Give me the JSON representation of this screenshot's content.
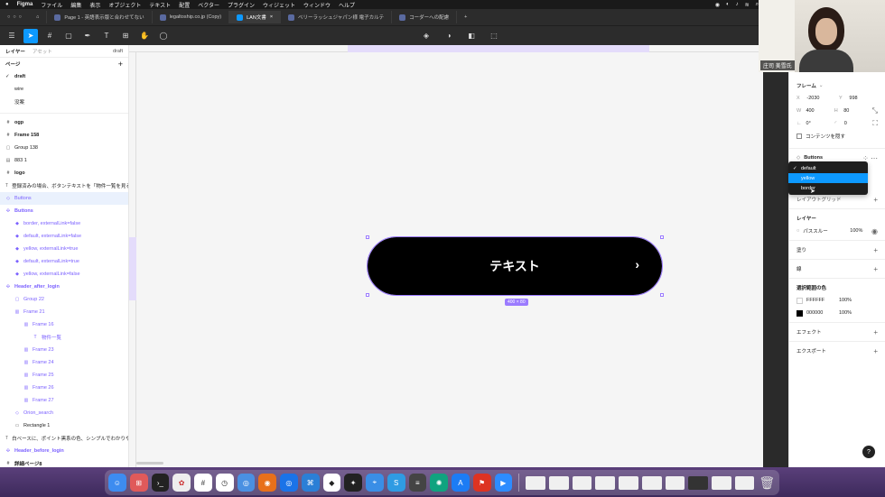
{
  "menubar": {
    "apple": "",
    "items": [
      "Figma",
      "ファイル",
      "編集",
      "表示",
      "オブジェクト",
      "テキスト",
      "配置",
      "ベクター",
      "プラグイン",
      "ウィジェット",
      "ウィンドウ",
      "ヘルプ"
    ]
  },
  "tabs": [
    {
      "label": "Page 1 - 英語表示版と合わせてない"
    },
    {
      "label": "legaltoship.co.jp (Copy)"
    },
    {
      "label": "LAN文書"
    },
    {
      "label": "ベリーラッシュジャパン様 電子カルテ"
    },
    {
      "label": "コーダーへの配慮"
    }
  ],
  "left_panel": {
    "tab_layers": "レイヤー",
    "tab_assets": "アセット",
    "version": "draft",
    "pages_title": "ページ",
    "add": "+",
    "pages": [
      {
        "label": "draft",
        "current": true
      },
      {
        "label": "wire",
        "current": false
      },
      {
        "label": "没案",
        "current": false
      }
    ],
    "layers": [
      {
        "label": "ogp",
        "indent": 0,
        "purple": false,
        "bold": true,
        "icon": "#",
        "hl": false
      },
      {
        "label": "Frame 158",
        "indent": 0,
        "purple": false,
        "bold": true,
        "icon": "#",
        "hl": false
      },
      {
        "label": "Group 138",
        "indent": 0,
        "purple": false,
        "bold": false,
        "icon": "▢",
        "hl": false
      },
      {
        "label": "883 1",
        "indent": 0,
        "purple": false,
        "bold": false,
        "icon": "▤",
        "hl": false
      },
      {
        "label": "logo",
        "indent": 0,
        "purple": false,
        "bold": true,
        "icon": "#",
        "hl": false
      },
      {
        "label": "登録済みの場合、ボタンテキストを「物件一覧を見る」",
        "indent": 0,
        "purple": false,
        "bold": false,
        "icon": "T",
        "hl": false
      },
      {
        "label": "Buttons",
        "indent": 0,
        "purple": true,
        "bold": false,
        "icon": "◇",
        "hl": true
      },
      {
        "label": "Buttons",
        "indent": 0,
        "purple": true,
        "bold": true,
        "icon": "✣",
        "hl": false
      },
      {
        "label": "border, externalLink=false",
        "indent": 1,
        "purple": true,
        "bold": false,
        "icon": "◆",
        "hl": false
      },
      {
        "label": "default, externalLink=false",
        "indent": 1,
        "purple": true,
        "bold": false,
        "icon": "◆",
        "hl": false
      },
      {
        "label": "yellow, externalLink=true",
        "indent": 1,
        "purple": true,
        "bold": false,
        "icon": "◆",
        "hl": false
      },
      {
        "label": "default, externalLink=true",
        "indent": 1,
        "purple": true,
        "bold": false,
        "icon": "◆",
        "hl": false
      },
      {
        "label": "yellow, externalLink=false",
        "indent": 1,
        "purple": true,
        "bold": false,
        "icon": "◆",
        "hl": false
      },
      {
        "label": "Header_after_login",
        "indent": 0,
        "purple": true,
        "bold": true,
        "icon": "✣",
        "hl": false
      },
      {
        "label": "Group 22",
        "indent": 1,
        "purple": true,
        "bold": false,
        "icon": "▢",
        "hl": false
      },
      {
        "label": "Frame 21",
        "indent": 1,
        "purple": true,
        "bold": false,
        "icon": "▥",
        "hl": false
      },
      {
        "label": "Frame 16",
        "indent": 2,
        "purple": true,
        "bold": false,
        "icon": "▥",
        "hl": false
      },
      {
        "label": "物件一覧",
        "indent": 3,
        "purple": true,
        "bold": false,
        "icon": "T",
        "hl": false
      },
      {
        "label": "Frame 23",
        "indent": 2,
        "purple": true,
        "bold": false,
        "icon": "▥",
        "hl": false
      },
      {
        "label": "Frame 24",
        "indent": 2,
        "purple": true,
        "bold": false,
        "icon": "▥",
        "hl": false
      },
      {
        "label": "Frame 25",
        "indent": 2,
        "purple": true,
        "bold": false,
        "icon": "▥",
        "hl": false
      },
      {
        "label": "Frame 26",
        "indent": 2,
        "purple": true,
        "bold": false,
        "icon": "▥",
        "hl": false
      },
      {
        "label": "Frame 27",
        "indent": 2,
        "purple": true,
        "bold": false,
        "icon": "▥",
        "hl": false
      },
      {
        "label": "Orion_search",
        "indent": 1,
        "purple": true,
        "bold": false,
        "icon": "◇",
        "hl": false
      },
      {
        "label": "Rectangle 1",
        "indent": 1,
        "purple": false,
        "bold": false,
        "icon": "▭",
        "hl": false
      },
      {
        "label": "白ベースに、ポイント黒系の色、シンプルでわかりや...",
        "indent": 0,
        "purple": false,
        "bold": false,
        "icon": "T",
        "hl": false
      },
      {
        "label": "Header_before_login",
        "indent": 0,
        "purple": true,
        "bold": true,
        "icon": "✣",
        "hl": false
      },
      {
        "label": "詳細ページ8",
        "indent": 0,
        "purple": false,
        "bold": true,
        "icon": "#",
        "hl": false
      }
    ]
  },
  "canvas": {
    "button_text": "テキスト",
    "chevron": "›",
    "size_badge": "400 × 80"
  },
  "webcam": {
    "name": "庄司 美雪氏"
  },
  "right_panel": {
    "frame_title": "フレーム",
    "x_label": "X",
    "x_value": "-2030",
    "y_label": "Y",
    "y_value": "998",
    "w_label": "W",
    "w_value": "400",
    "h_label": "H",
    "h_value": "80",
    "rot_value": "0°",
    "radius_value": "0",
    "clip_label": "コンテンツを隠す",
    "component_name": "Buttons",
    "layout_grid": "レイアウトグリッド",
    "layer_title": "レイヤー",
    "pass_through": "パススルー",
    "opacity": "100%",
    "fill_title": "塗り",
    "stroke_title": "線",
    "selection_colors_title": "選択範囲の色",
    "colors": [
      {
        "hex": "FFFFFF",
        "opacity": "100%",
        "swatch": "#ffffff"
      },
      {
        "hex": "000000",
        "opacity": "100%",
        "swatch": "#000000"
      }
    ],
    "effects": "エフェクト",
    "export": "エクスポート"
  },
  "dropdown": {
    "items": [
      {
        "label": "default",
        "checked": true,
        "highlighted": false
      },
      {
        "label": "yellow",
        "checked": false,
        "highlighted": true
      },
      {
        "label": "border",
        "checked": false,
        "highlighted": false
      }
    ]
  },
  "help": "?",
  "colors": {
    "accent": "#0d99ff",
    "selection": "#9b7bff",
    "component_purple": "#7b61ff"
  }
}
